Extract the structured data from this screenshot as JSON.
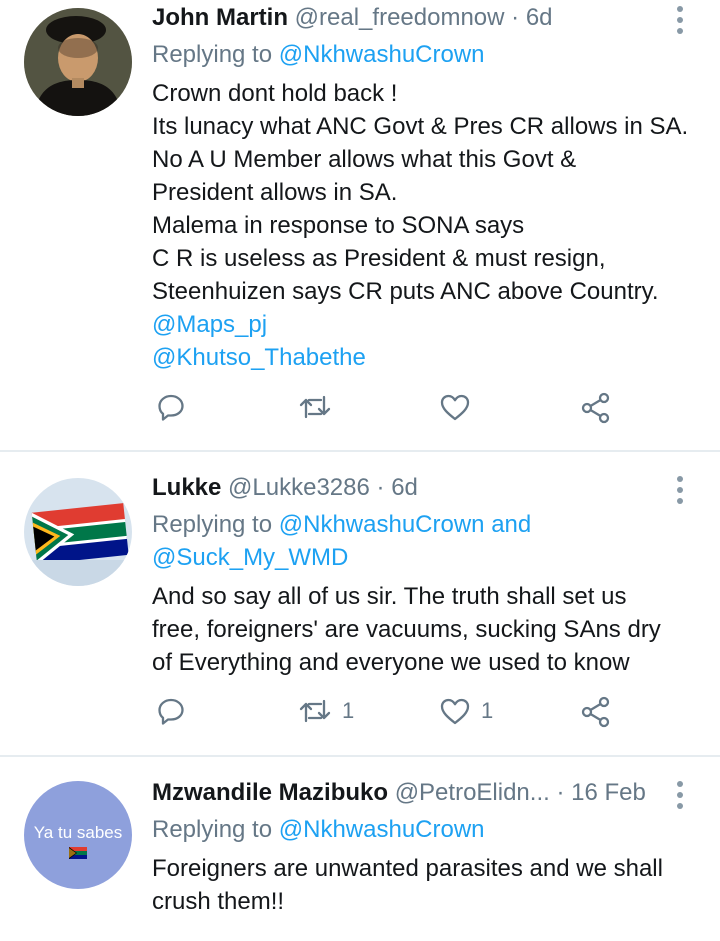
{
  "tweets": [
    {
      "name": "John Martin",
      "handle": "@real_freedomnow",
      "dot": "·",
      "time": "6d",
      "replying_prefix": "Replying to ",
      "replying_to": "@NkhwashuCrown",
      "body_lines": [
        "Crown dont hold back !",
        "Its lunacy what ANC Govt & Pres CR allows in SA.",
        "No A U Member allows what this Govt &",
        "President allows in SA.",
        "Malema in response to SONA says",
        "C R is useless as President & must resign,",
        "Steenhuizen says CR puts ANC above Country."
      ],
      "mentions": [
        "@Maps_pj",
        "@Khutso_Thabethe"
      ],
      "retweet_count": "",
      "like_count": ""
    },
    {
      "name": "Lukke",
      "handle": "@Lukke3286",
      "dot": "·",
      "time": "6d",
      "replying_prefix": "Replying to ",
      "replying_to": "@NkhwashuCrown and",
      "replying_to_2": "@Suck_My_WMD",
      "body_lines": [
        "And so say all of us sir. The truth shall set us",
        "free, foreigners' are vacuums, sucking SAns dry",
        "of Everything and everyone we used to know"
      ],
      "retweet_count": "1",
      "like_count": "1"
    },
    {
      "name": "Mzwandile Mazibuko",
      "handle": "@PetroElidn...",
      "dot": "·",
      "time": "16 Feb",
      "avatar_text": "Ya tu sabes",
      "replying_prefix": "Replying to ",
      "replying_to": "@NkhwashuCrown",
      "body_lines": [
        "Foreigners are unwanted parasites and we shall",
        "crush them!!"
      ]
    }
  ],
  "colors": {
    "link": "#1da1f2",
    "muted": "#657786",
    "divider": "#e6ecf0",
    "avatar3_bg": "#8ea0dc"
  },
  "icons": [
    "reply-icon",
    "retweet-icon",
    "like-icon",
    "share-icon",
    "more-icon"
  ]
}
